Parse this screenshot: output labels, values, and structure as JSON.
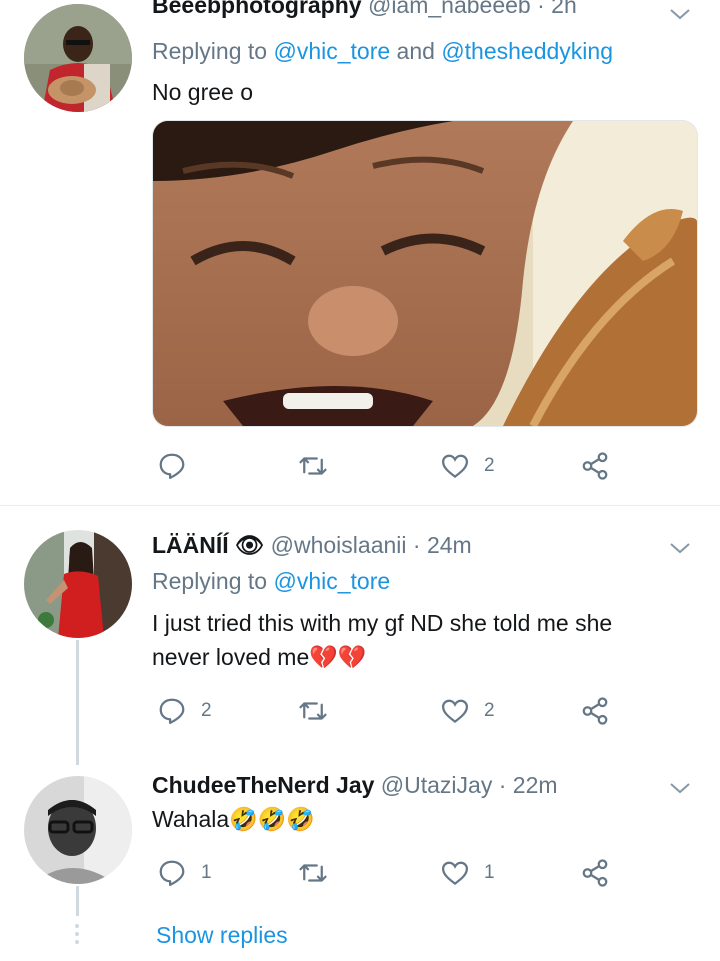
{
  "tweets": [
    {
      "name": "Beeebphotography",
      "handle": "@iam_nabeeeb",
      "separator": "·",
      "time": "2h",
      "replying_prefix": "Replying to ",
      "replying_to_1": "@vhic_tore",
      "replying_and": " and ",
      "replying_to_2": "@thesheddyking",
      "text": "No gree o",
      "reply_count": "",
      "retweet_count": "",
      "like_count": "2"
    },
    {
      "name": "LÄÄNÍÍ 👁",
      "handle": "@whoislaanii",
      "separator": "·",
      "time": "24m",
      "replying_prefix": "Replying to ",
      "replying_to_1": "@vhic_tore",
      "text_line1": "I just tried this with my gf ND she told me she",
      "text_line2": "never loved me💔💔",
      "reply_count": "2",
      "retweet_count": "",
      "like_count": "2"
    },
    {
      "name": "ChudeeTheNerd Jay",
      "handle": "@UtaziJay",
      "separator": "·",
      "time": "22m",
      "text": "Wahala🤣🤣🤣",
      "reply_count": "1",
      "retweet_count": "",
      "like_count": "1"
    }
  ],
  "show_replies": "Show replies",
  "colors": {
    "accent": "#1b95e0",
    "secondary_text": "#657786",
    "icon": "#657786",
    "divider": "#e6ecf0"
  }
}
